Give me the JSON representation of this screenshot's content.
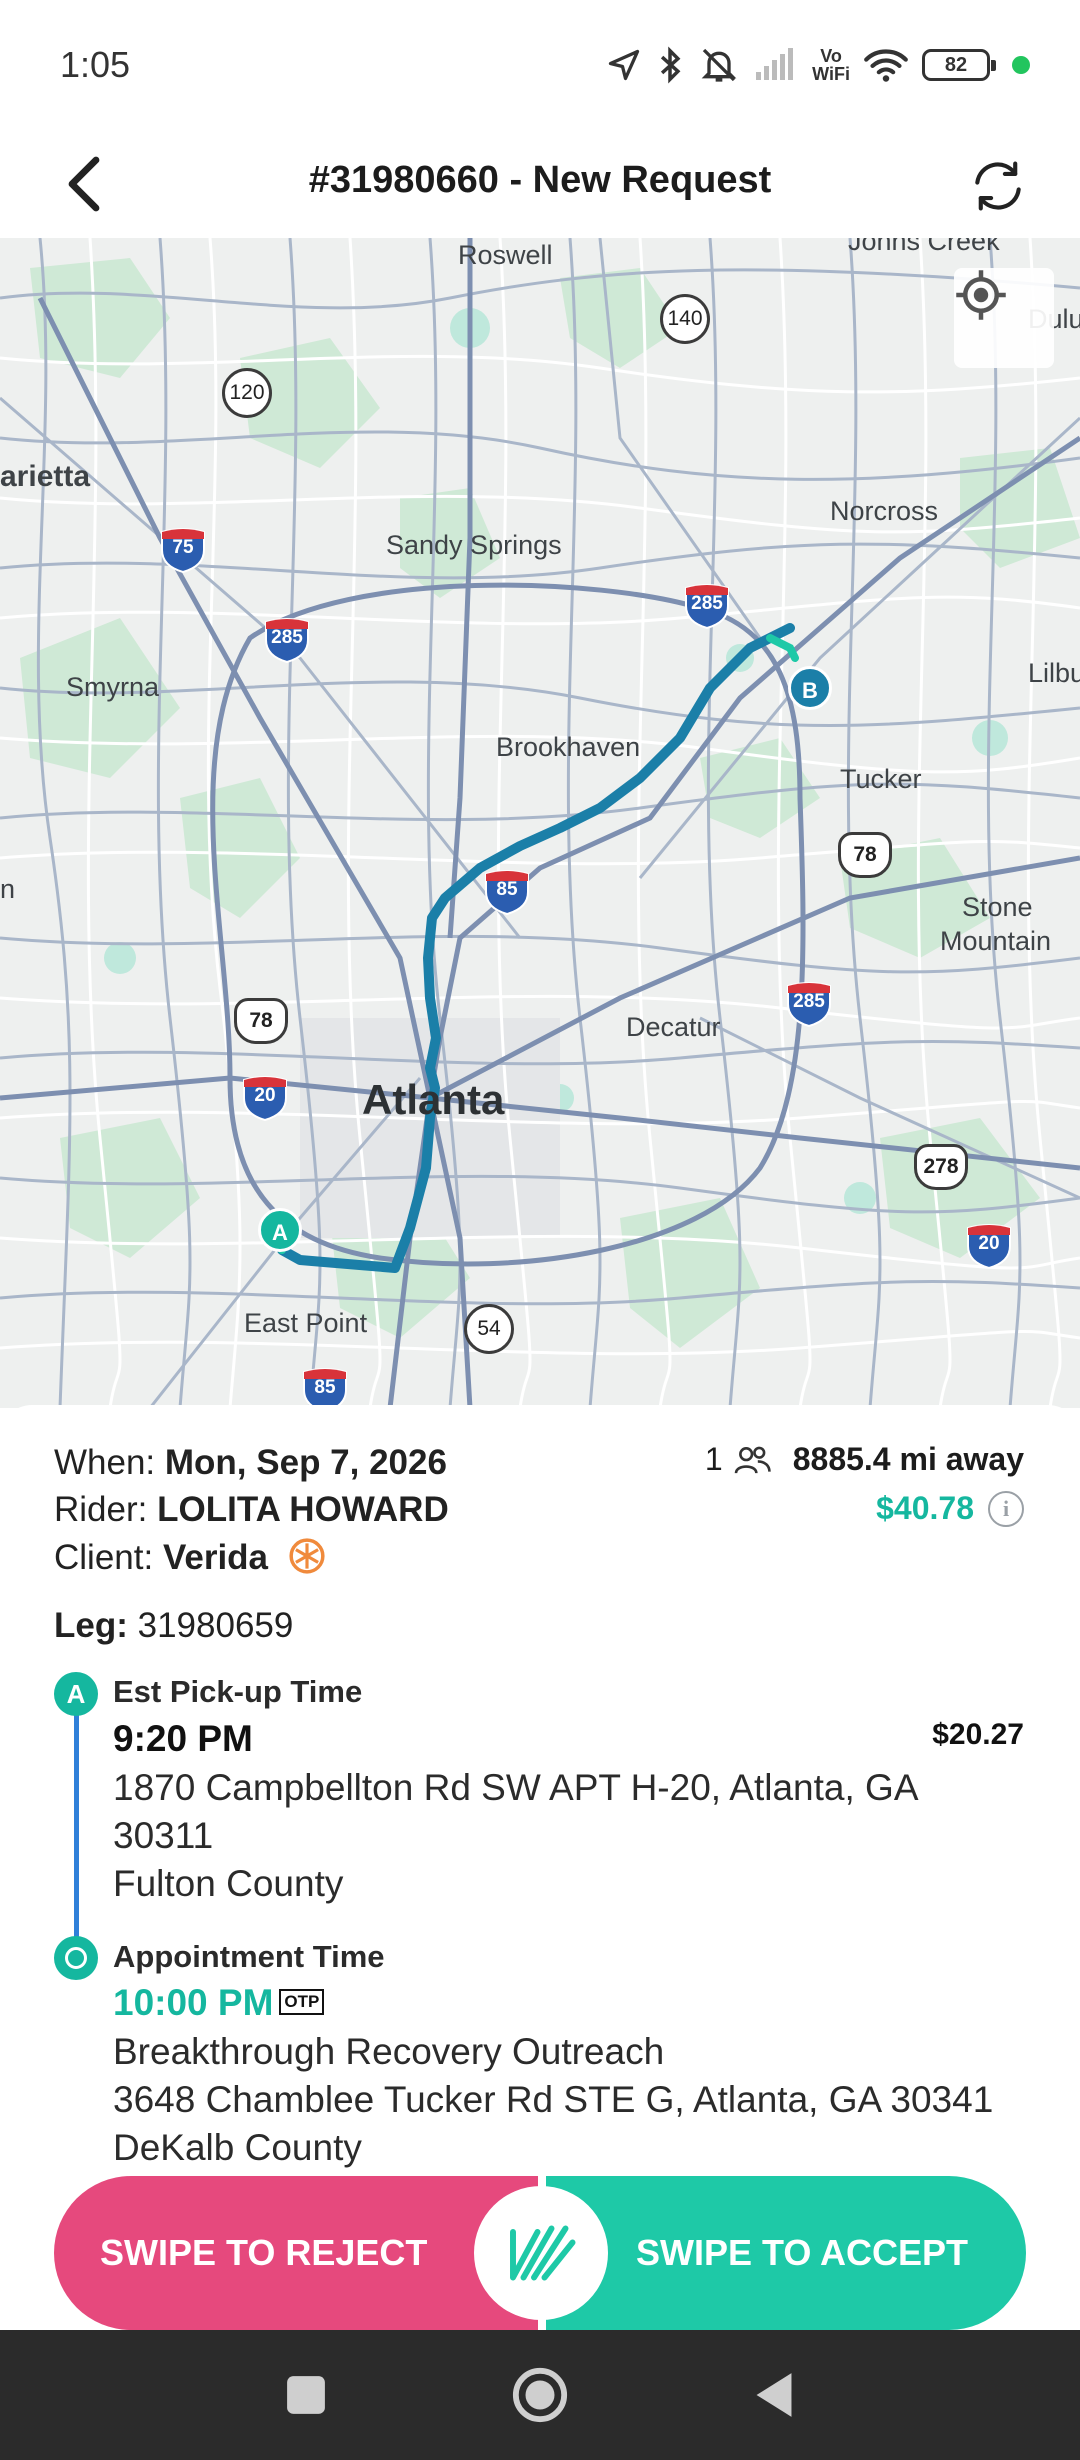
{
  "status_bar": {
    "time": "1:05",
    "battery": "82",
    "vowifi_top": "Vo",
    "vowifi_bottom": "WiFi"
  },
  "header": {
    "title": "#31980660 - New Request"
  },
  "map": {
    "places": [
      "Roswell",
      "Johns Creek",
      "Dulu",
      "arietta",
      "Sandy Springs",
      "Norcross",
      "Smyrna",
      "Lilbu",
      "Brookhaven",
      "Tucker",
      "Stone",
      "Mountain",
      "Decatur",
      "Atlanta",
      "East Point",
      "n"
    ],
    "interstates": [
      "75",
      "285",
      "285",
      "85",
      "285",
      "20",
      "20",
      "85"
    ],
    "us_routes": [
      "78",
      "78",
      "278"
    ],
    "state_routes": [
      "120",
      "140",
      "54"
    ],
    "marker_a": "A",
    "marker_b": "B",
    "route_color": "#1b7fa8"
  },
  "trip": {
    "when_label": "When:",
    "when_value": "Mon, Sep 7, 2026",
    "rider_label": "Rider:",
    "rider_value": "LOLITA HOWARD",
    "client_label": "Client:",
    "client_value": "Verida",
    "passengers": "1",
    "distance": "8885.4 mi away",
    "total_price": "$40.78",
    "leg_label": "Leg:",
    "leg_value": "31980659"
  },
  "pickup": {
    "badge": "A",
    "label": "Est Pick-up Time",
    "time": "9:20 PM",
    "price": "$20.27",
    "address_line1": "1870 Campbellton Rd SW APT H-20, Atlanta, GA",
    "address_line2": "30311",
    "county": "Fulton County"
  },
  "dropoff": {
    "label": "Appointment Time",
    "time": "10:00 PM",
    "otp": "OTP",
    "name": "Breakthrough Recovery Outreach",
    "address": "3648 Chamblee Tucker Rd STE G, Atlanta, GA 30341",
    "county": "DeKalb County"
  },
  "swipe": {
    "reject": "SWIPE TO REJECT",
    "accept": "SWIPE TO ACCEPT"
  },
  "colors": {
    "accent": "#15b79f",
    "reject": "#e6497d",
    "accept": "#1ec9a7",
    "timeline": "#2f80d9"
  }
}
